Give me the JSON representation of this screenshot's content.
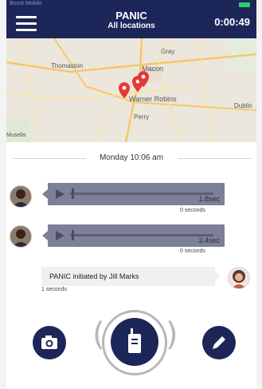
{
  "header": {
    "status_left": "Boost Mobile",
    "title": "PANIC",
    "subtitle": "All locations",
    "timer": "0:00:49"
  },
  "map": {
    "labels": [
      "Gray",
      "Thomaston",
      "Macon",
      "Warner Robins",
      "Perry",
      "Dublin",
      "Musella"
    ],
    "pins": 3
  },
  "separator": {
    "text": "Monday 10:06 am"
  },
  "messages": [
    {
      "type": "audio",
      "duration": "1.8sec",
      "elapsed": "0 seconds"
    },
    {
      "type": "audio",
      "duration": "3.4sec",
      "elapsed": "0 seconds"
    },
    {
      "type": "text",
      "text": "PANIC initiated by Jill Marks",
      "elapsed": "1 seconds"
    }
  ],
  "controls": {
    "camera_icon": "camera-icon",
    "ptt_icon": "walkie-talkie-icon",
    "edit_icon": "pencil-icon"
  },
  "colors": {
    "header_bg": "#1d2659",
    "bubble": "#7d8096",
    "battery": "#2ecc71"
  }
}
